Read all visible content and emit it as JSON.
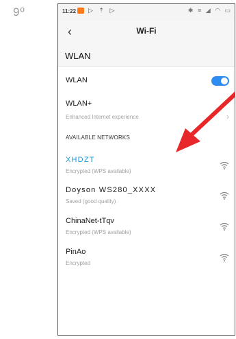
{
  "step": "9º",
  "status": {
    "time": "11:22"
  },
  "topbar": {
    "title": "Wi-Fi"
  },
  "header": {
    "title": "WLAN"
  },
  "wlan": {
    "label": "WLAN",
    "enabled": true
  },
  "wlan_plus": {
    "label": "WLAN+",
    "sub": "Enhanced Internet experience"
  },
  "section": {
    "title": "AVAILABLE NETWORKS"
  },
  "networks": [
    {
      "name": "XHDZT",
      "status": "Encrypted (WPS available)",
      "highlight": "#1b9ad6"
    },
    {
      "name": "Doyson WS280_XXXX",
      "status": "Saved (good quality)"
    },
    {
      "name": "ChinaNet-tTqv",
      "status": "Encrypted (WPS available)"
    },
    {
      "name": "PinAo",
      "status": "Encrypted"
    }
  ],
  "colors": {
    "toggle": "#2f8cf0",
    "arrow": "#e8272a",
    "accent": "#1b9ad6"
  },
  "icons": {
    "back": "chevron-left-icon",
    "wifi": "wifi-signal-icon",
    "arrow": "red-pointer-arrow"
  }
}
